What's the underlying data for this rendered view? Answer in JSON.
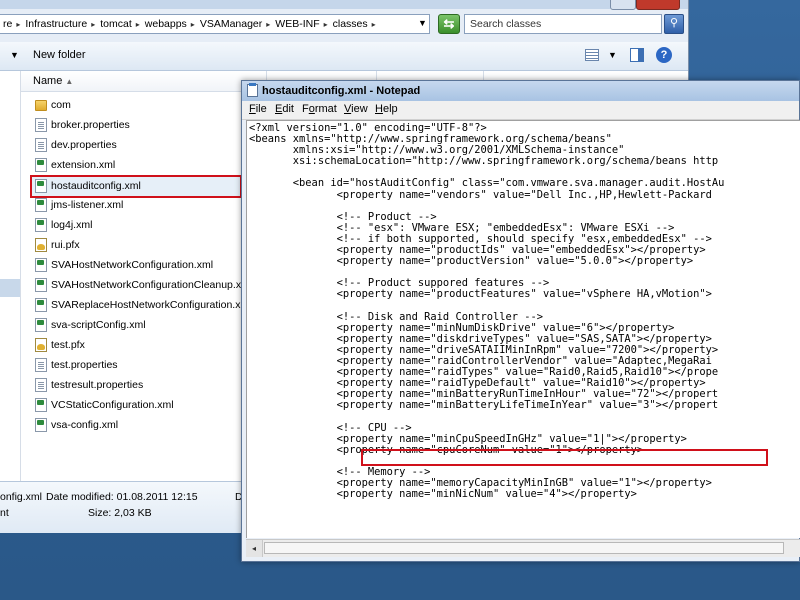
{
  "explorer": {
    "breadcrumbs": [
      "re",
      "Infrastructure",
      "tomcat",
      "webapps",
      "VSAManager",
      "WEB-INF",
      "classes"
    ],
    "search_placeholder": "Search classes",
    "toolbar": {
      "new_folder": "New folder"
    },
    "column_name": "Name",
    "files": [
      {
        "name": "com",
        "icon": "folder-icon"
      },
      {
        "name": "broker.properties",
        "icon": "document-icon"
      },
      {
        "name": "dev.properties",
        "icon": "document-icon"
      },
      {
        "name": "extension.xml",
        "icon": "xml-file-icon"
      },
      {
        "name": "hostauditconfig.xml",
        "icon": "xml-file-icon",
        "selected": true
      },
      {
        "name": "jms-listener.xml",
        "icon": "xml-file-icon"
      },
      {
        "name": "log4j.xml",
        "icon": "xml-file-icon"
      },
      {
        "name": "rui.pfx",
        "icon": "certificate-icon"
      },
      {
        "name": "SVAHostNetworkConfiguration.xml",
        "icon": "xml-file-icon"
      },
      {
        "name": "SVAHostNetworkConfigurationCleanup.xml",
        "icon": "xml-file-icon"
      },
      {
        "name": "SVAReplaceHostNetworkConfiguration.xml",
        "icon": "xml-file-icon"
      },
      {
        "name": "sva-scriptConfig.xml",
        "icon": "xml-file-icon"
      },
      {
        "name": "test.pfx",
        "icon": "certificate-icon"
      },
      {
        "name": "test.properties",
        "icon": "document-icon"
      },
      {
        "name": "testresult.properties",
        "icon": "document-icon"
      },
      {
        "name": "VCStaticConfiguration.xml",
        "icon": "xml-file-icon"
      },
      {
        "name": "vsa-config.xml",
        "icon": "xml-file-icon"
      }
    ],
    "details": {
      "name_fragment": "onfig.xml",
      "modified": "Date modified: 01.08.2011 12:15",
      "type_fragment": "nt",
      "size": "Size: 2,03 KB",
      "extra": "D"
    }
  },
  "notepad": {
    "title": "hostauditconfig.xml - Notepad",
    "menu": [
      "File",
      "Edit",
      "Format",
      "View",
      "Help"
    ],
    "lines": [
      "<?xml version=\"1.0\" encoding=\"UTF-8\"?>",
      "<beans xmlns=\"http://www.springframework.org/schema/beans\"",
      "       xmlns:xsi=\"http://www.w3.org/2001/XMLSchema-instance\"",
      "       xsi:schemaLocation=\"http://www.springframework.org/schema/beans http",
      "",
      "       <bean id=\"hostAuditConfig\" class=\"com.vmware.sva.manager.audit.HostAu",
      "              <property name=\"vendors\" value=\"Dell Inc.,HP,Hewlett-Packard",
      "",
      "              <!-- Product -->",
      "              <!-- \"esx\": VMware ESX; \"embeddedEsx\": VMware ESXi -->",
      "              <!-- if both supported, should specify \"esx,embeddedEsx\" -->",
      "              <property name=\"productIds\" value=\"embeddedEsx\"></property>",
      "              <property name=\"productVersion\" value=\"5.0.0\"></property>",
      "",
      "              <!-- Product suppored features -->",
      "              <property name=\"productFeatures\" value=\"vSphere HA,vMotion\">",
      "",
      "              <!-- Disk and Raid Controller -->",
      "              <property name=\"minNumDiskDrive\" value=\"6\"></property>",
      "              <property name=\"diskdriveTypes\" value=\"SAS,SATA\"></property>",
      "              <property name=\"driveSATAIIMinInRpm\" value=\"7200\"></property>",
      "              <property name=\"raidControllerVendor\" value=\"Adaptec,MegaRai",
      "              <property name=\"raidTypes\" value=\"Raid0,Raid5,Raid10\"></prope",
      "              <property name=\"raidTypeDefault\" value=\"Raid10\"></property>",
      "              <property name=\"minBatteryRunTimeInHour\" value=\"72\"></propert",
      "              <property name=\"minBatteryLifeTimeInYear\" value=\"3\"></propert",
      "",
      "              <!-- CPU -->",
      "              <property name=\"minCpuSpeedInGHz\" value=\"1|\"></property>",
      "              <property name=\"cpuCoreNum\" value=\"1\"></property>",
      "",
      "              <!-- Memory -->",
      "              <property name=\"memoryCapacityMinInGB\" value=\"1\"></property>",
      "              <property name=\"minNicNum\" value=\"4\"></property>"
    ]
  }
}
